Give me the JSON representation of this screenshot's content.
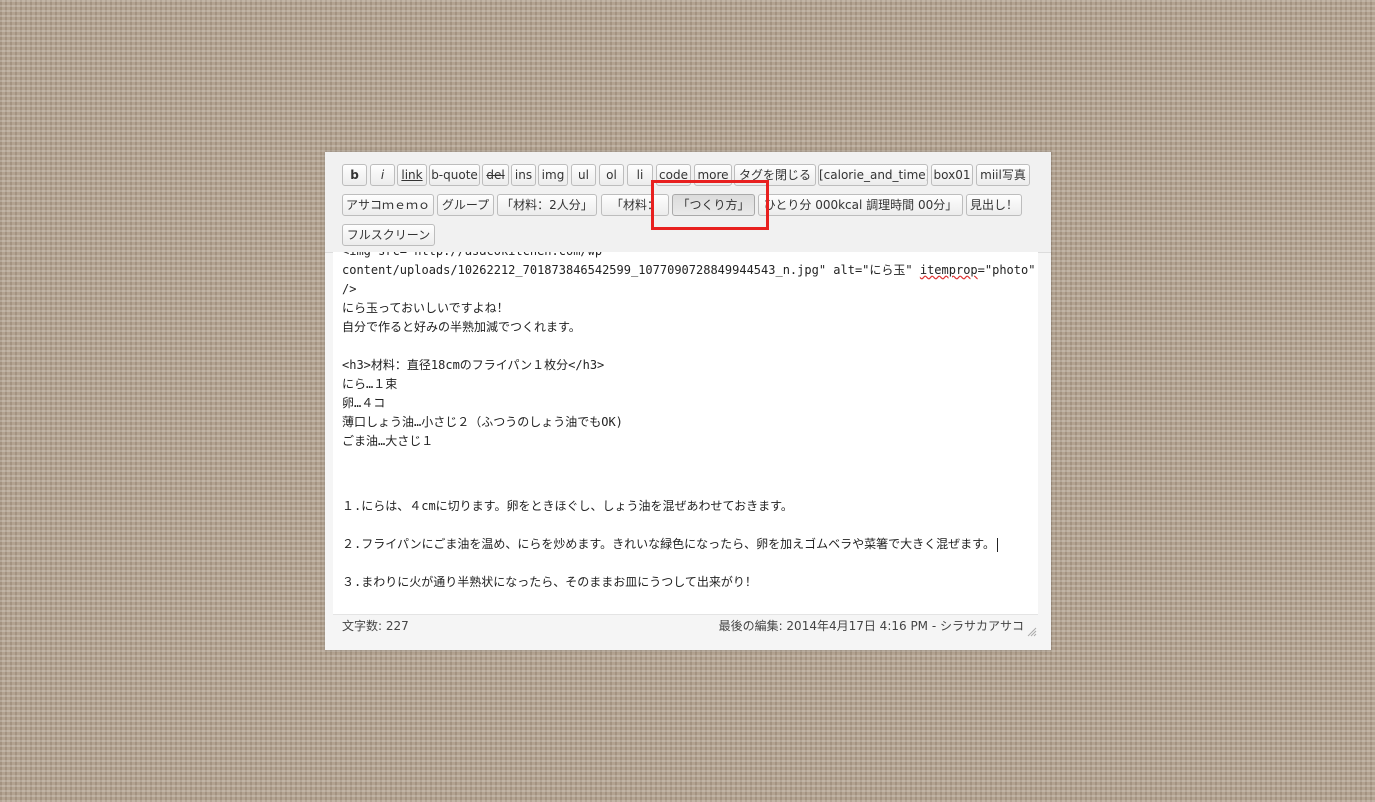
{
  "toolbar": {
    "buttons_row1": [
      {
        "label": "b"
      },
      {
        "label": "i"
      },
      {
        "label": "link"
      },
      {
        "label": "b-quote"
      },
      {
        "label": "del"
      },
      {
        "label": "ins"
      },
      {
        "label": "img"
      },
      {
        "label": "ul"
      },
      {
        "label": "ol"
      },
      {
        "label": "li"
      },
      {
        "label": "code"
      },
      {
        "label": "more"
      },
      {
        "label": "タグを閉じる"
      },
      {
        "label": "[calorie_and_time]"
      },
      {
        "label": "box01"
      },
      {
        "label": "miil写真"
      }
    ],
    "buttons_row2": [
      {
        "label": "アサコｍｅｍｏ"
      },
      {
        "label": "グループ"
      },
      {
        "label": "「材料：2人分」"
      },
      {
        "label": "「材料："
      },
      {
        "label": "「つくり方」"
      },
      {
        "label": "ひとり分 000kcal 調理時間 00分」"
      },
      {
        "label": "見出し！"
      }
    ],
    "buttons_row3": [
      {
        "label": "フルスクリーン"
      }
    ]
  },
  "content": {
    "line0": "<img src=\"http://asacokitchen.com/wp-",
    "line1_pre": "content/uploads/10262212_701873846542599_1077090728849944543_n.jpg\" alt=\"にら玉\" ",
    "line1_spell": "itemprop",
    "line1_post": "=\"photo\"",
    "line2": "/>",
    "line3": "にら玉っておいしいですよね！",
    "line4": "自分で作ると好みの半熟加減でつくれます。",
    "line5": "<h3>材料：直径18cmのフライパン１枚分</h3>",
    "line6": "にら…１束",
    "line7": "卵…４コ",
    "line8": "薄口しょう油…小さじ２（ふつうのしょう油でもOK)",
    "line9": "ごま油…大さじ１",
    "step1": "１.にらは、４cmに切ります。卵をときほぐし、しょう油を混ぜあわせておきます。",
    "step2": "２.フライパンにごま油を温め、にらを炒めます。きれいな緑色になったら、卵を加えゴムベラや菜箸で大きく混ぜます。",
    "step3": "３.まわりに火が通り半熟状になったら、そのままお皿にうつして出来がり！"
  },
  "status": {
    "word_count": "文字数: 227",
    "last_edit": "最後の編集: 2014年4月17日 4:16 PM - シラサカアサコ"
  },
  "colors": {
    "highlight": "#e8201f",
    "background": "#b3a391"
  },
  "icons": {
    "resize": "resize-grip-icon"
  }
}
